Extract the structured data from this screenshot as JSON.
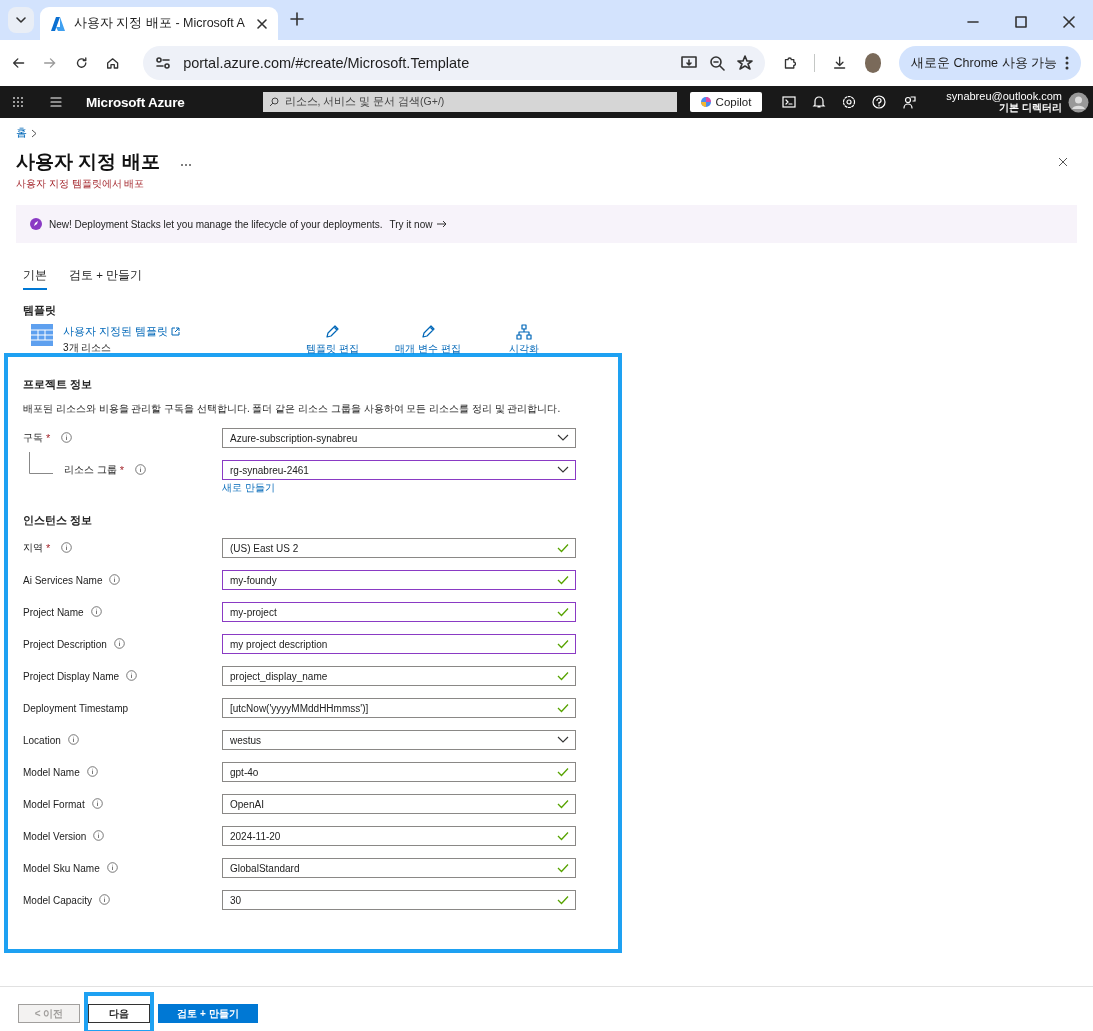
{
  "browser": {
    "tab_title": "사용자 지정 배포 - Microsoft A",
    "url": "portal.azure.com/#create/Microsoft.Template",
    "update_button": "새로운 Chrome 사용 가능"
  },
  "portal": {
    "brand": "Microsoft Azure",
    "search": {
      "placeholder": "리소스, 서비스 및 문서 검색(G+/)"
    },
    "copilot": "Copilot",
    "user": "synabreu@outlook.com",
    "directory": "기본 디렉터리"
  },
  "breadcrumb": [
    "홈"
  ],
  "title": "사용자 지정 배포",
  "subtitle": "사용자 지정 템플릿에서 배포",
  "banner": {
    "text": "New! Deployment Stacks let you manage the lifecycle of your deployments.",
    "link": "Try it now"
  },
  "tabs": [
    {
      "label": "기본",
      "selected": true
    },
    {
      "label": "검토 + 만들기",
      "selected": false
    }
  ],
  "template": {
    "heading": "템플릿",
    "name": "사용자 지정된 템플릿",
    "resources": "3개 리소스",
    "actions": [
      {
        "label": "템플릿 편집",
        "kind": "edit"
      },
      {
        "label": "매개 변수 편집",
        "kind": "edit"
      },
      {
        "label": "시각화",
        "kind": "visualize"
      }
    ]
  },
  "sections": [
    {
      "heading": "프로젝트 정보",
      "description": "배포된 리소스와 비용을 관리할 구독을 선택합니다. 폴더 같은 리소스 그룹을 사용하여 모든 리소스를 정리 및 관리합니다.",
      "fields": [
        {
          "label": "구독",
          "required_mark": "*",
          "info": true,
          "kind": "dropdown",
          "value": "Azure-subscription-synabreu",
          "valid": false,
          "focused": false,
          "child": false
        },
        {
          "label": "리소스 그룹",
          "required_mark": "*",
          "info": true,
          "kind": "dropdown",
          "value": "rg-synabreu-2461",
          "valid": false,
          "focused": true,
          "child": true,
          "link": "새로 만들기"
        }
      ]
    },
    {
      "heading": "인스턴스 정보",
      "fields": [
        {
          "label": "지역",
          "required_mark": "*",
          "info": true,
          "kind": "text",
          "value": "(US) East US 2",
          "valid": true,
          "focused": false,
          "child": false
        },
        {
          "label": "Ai Services Name",
          "info": true,
          "kind": "text",
          "value": "my-foundy",
          "valid": true,
          "focused": true,
          "child": false
        },
        {
          "label": "Project Name",
          "info": true,
          "kind": "text",
          "value": "my-project",
          "valid": true,
          "focused": true,
          "child": false
        },
        {
          "label": "Project Description",
          "info": true,
          "kind": "text",
          "value": "my project description",
          "valid": true,
          "focused": true,
          "child": false
        },
        {
          "label": "Project Display Name",
          "info": true,
          "kind": "text",
          "value": "project_display_name",
          "valid": true,
          "focused": false,
          "child": false
        },
        {
          "label": "Deployment Timestamp",
          "info": false,
          "kind": "text",
          "value": "[utcNow('yyyyMMddHHmmss')]",
          "valid": true,
          "focused": false,
          "child": false
        },
        {
          "label": "Location",
          "info": true,
          "kind": "dropdown",
          "value": "westus",
          "valid": false,
          "focused": false,
          "child": false
        },
        {
          "label": "Model Name",
          "info": true,
          "kind": "text",
          "value": "gpt-4o",
          "valid": true,
          "focused": false,
          "child": false
        },
        {
          "label": "Model Format",
          "info": true,
          "kind": "text",
          "value": "OpenAI",
          "valid": true,
          "focused": false,
          "child": false
        },
        {
          "label": "Model Version",
          "info": true,
          "kind": "text",
          "value": "2024-11-20",
          "valid": true,
          "focused": false,
          "child": false
        },
        {
          "label": "Model Sku Name",
          "info": true,
          "kind": "text",
          "value": "GlobalStandard",
          "valid": true,
          "focused": false,
          "child": false
        },
        {
          "label": "Model Capacity",
          "info": true,
          "kind": "text",
          "value": "30",
          "valid": true,
          "focused": false,
          "child": false
        }
      ]
    }
  ],
  "footer": [
    {
      "label": "< 이전",
      "kind": "secondary",
      "disabled": true,
      "highlighted": false
    },
    {
      "label": "다음",
      "kind": "secondary",
      "disabled": false,
      "highlighted": true
    },
    {
      "label": "검토 + 만들기",
      "kind": "primary",
      "disabled": false,
      "highlighted": false
    }
  ]
}
